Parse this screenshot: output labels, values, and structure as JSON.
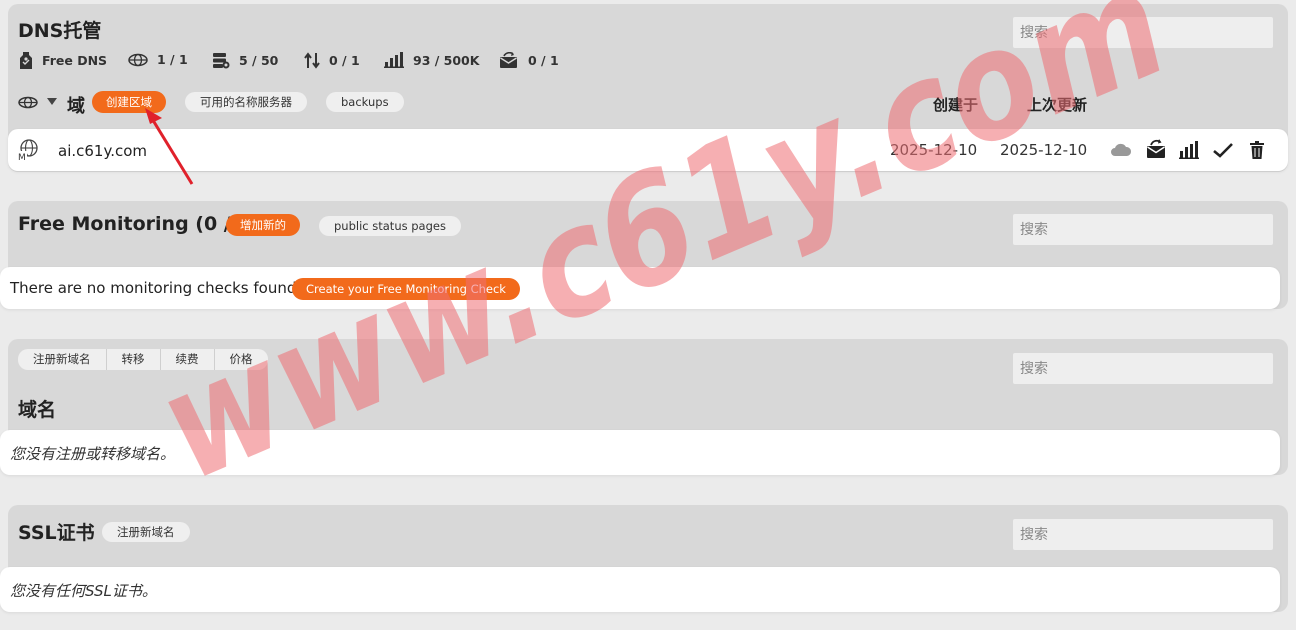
{
  "dns": {
    "title": "DNS托管",
    "search_placeholder": "搜索",
    "stats": [
      {
        "icon": "tag-icon",
        "value": "Free DNS"
      },
      {
        "icon": "zone-icon",
        "value": "1 / 1"
      },
      {
        "icon": "server-records-icon",
        "value": "5 / 50"
      },
      {
        "icon": "transfer-arrows-icon",
        "value": "0 / 1"
      },
      {
        "icon": "bar-chart-icon",
        "value": "93 / 500K"
      },
      {
        "icon": "mail-forward-icon",
        "value": "0 / 1"
      }
    ],
    "domain_label": "域",
    "create_zone": "创建区域",
    "nameservers": "可用的名称服务器",
    "backups": "backups",
    "col_created": "创建于",
    "col_updated": "上次更新",
    "row": {
      "domain": "ai.c61y.com",
      "created": "2025-12-10",
      "updated": "2025-12-10"
    }
  },
  "monitoring": {
    "title": "Free Monitoring (0 / 1)",
    "add_new": "增加新的",
    "status_pages": "public status pages",
    "search_placeholder": "搜索",
    "empty": "There are no monitoring checks found.",
    "create_check": "Create your Free Monitoring Check"
  },
  "domains": {
    "tabs": [
      "注册新域名",
      "转移",
      "续费",
      "价格"
    ],
    "search_placeholder": "搜索",
    "title": "域名",
    "empty": "您没有注册或转移域名。"
  },
  "ssl": {
    "title": "SSL证书",
    "register": "注册新域名",
    "search_placeholder": "搜索",
    "empty": "您没有任何SSL证书。"
  },
  "watermark": "www.c61y.com",
  "colors": {
    "accent": "#f26a1b",
    "panel": "#d8d8d8",
    "watermark": "#ee6e72",
    "arrow": "#e0212b"
  }
}
